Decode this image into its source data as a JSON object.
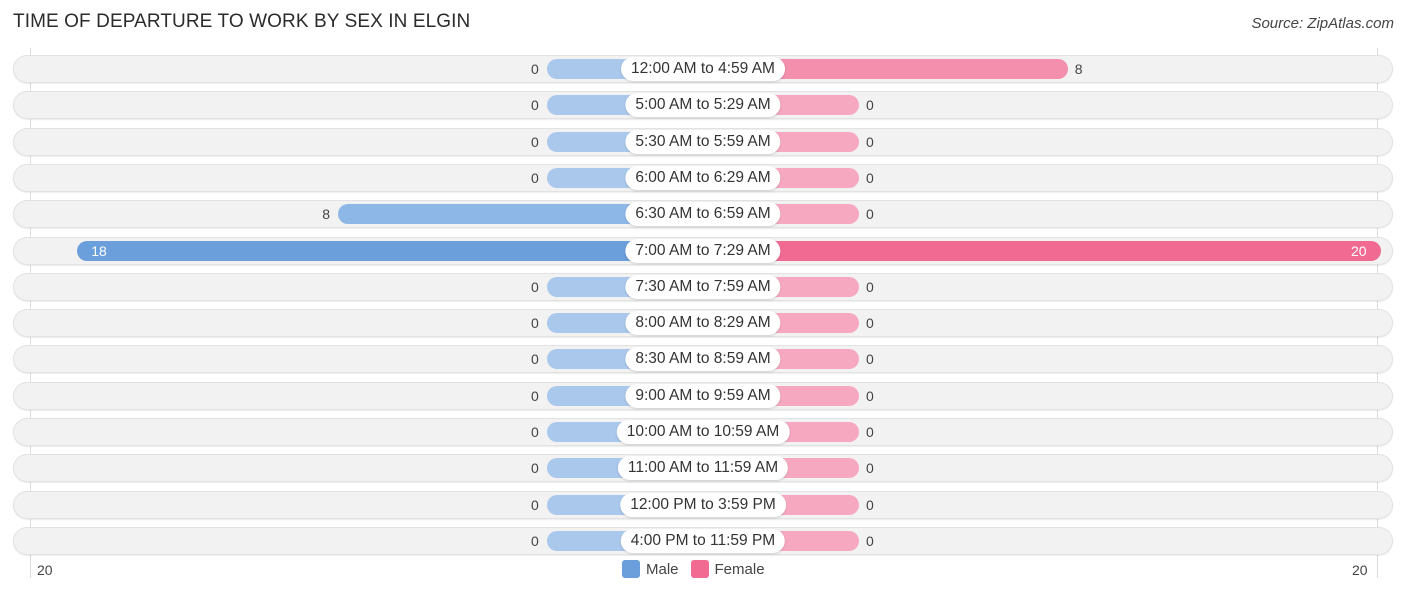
{
  "title": "TIME OF DEPARTURE TO WORK BY SEX IN ELGIN",
  "source": "Source: ZipAtlas.com",
  "colors": {
    "male": "#6a9fdb",
    "female": "#f06a92"
  },
  "chart_data": {
    "type": "bar",
    "orientation": "horizontal-diverging",
    "title": "TIME OF DEPARTURE TO WORK BY SEX IN ELGIN",
    "categories": [
      "12:00 AM to 4:59 AM",
      "5:00 AM to 5:29 AM",
      "5:30 AM to 5:59 AM",
      "6:00 AM to 6:29 AM",
      "6:30 AM to 6:59 AM",
      "7:00 AM to 7:29 AM",
      "7:30 AM to 7:59 AM",
      "8:00 AM to 8:29 AM",
      "8:30 AM to 8:59 AM",
      "9:00 AM to 9:59 AM",
      "10:00 AM to 10:59 AM",
      "11:00 AM to 11:59 AM",
      "12:00 PM to 3:59 PM",
      "4:00 PM to 11:59 PM"
    ],
    "series": [
      {
        "name": "Male",
        "values": [
          0,
          0,
          0,
          0,
          8,
          18,
          0,
          0,
          0,
          0,
          0,
          0,
          0,
          0
        ]
      },
      {
        "name": "Female",
        "values": [
          8,
          0,
          0,
          0,
          0,
          20,
          0,
          0,
          0,
          0,
          0,
          0,
          0,
          0
        ]
      }
    ],
    "axis_ticks": {
      "left": "20",
      "right": "20"
    },
    "xlim": [
      -20,
      20
    ],
    "legend": {
      "position": "bottom-center",
      "entries": [
        "Male",
        "Female"
      ]
    }
  }
}
